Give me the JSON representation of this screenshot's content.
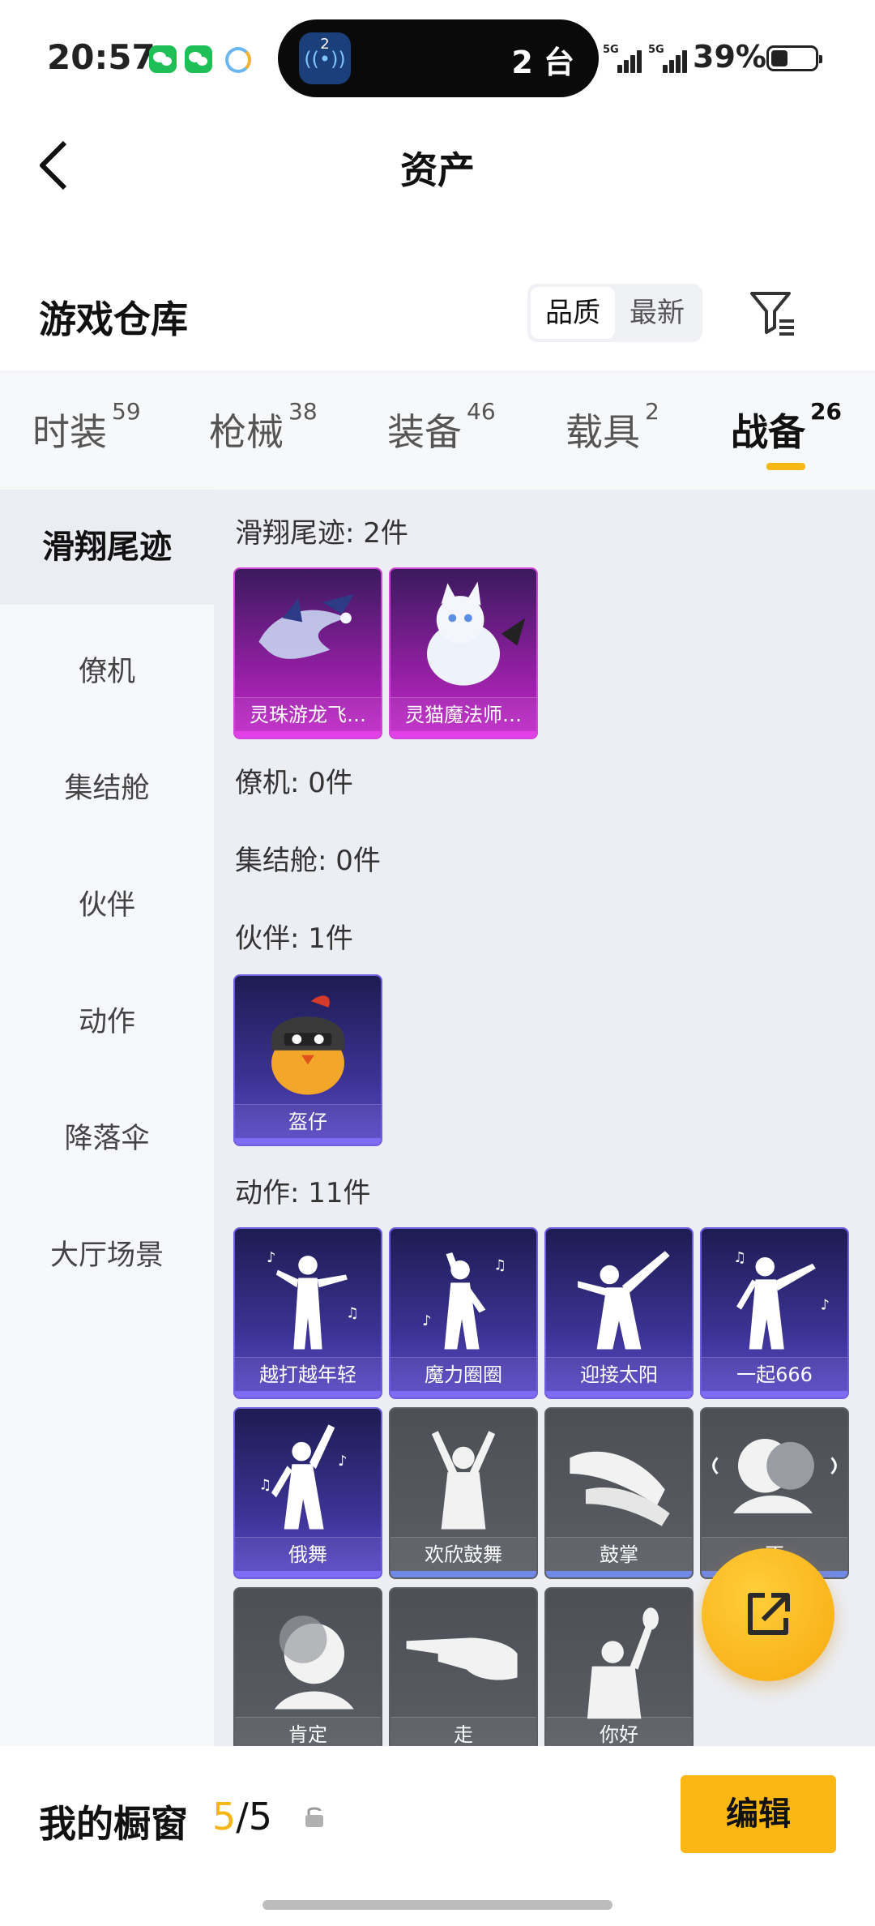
{
  "status_bar": {
    "time": "20:57",
    "island_app_badge": "2",
    "island_text": "2 台",
    "network_1": "5G",
    "network_2": "5G",
    "battery_percent": "39%",
    "battery_level": 0.39
  },
  "nav": {
    "title": "资产",
    "back_icon": "chevron-left-icon"
  },
  "header": {
    "section_title": "游戏仓库",
    "sort_options": [
      "品质",
      "最新"
    ],
    "sort_selected": "品质",
    "filter_icon": "filter-icon"
  },
  "tabs": [
    {
      "label": "时装",
      "count": "59"
    },
    {
      "label": "枪械",
      "count": "38"
    },
    {
      "label": "装备",
      "count": "46"
    },
    {
      "label": "载具",
      "count": "2"
    },
    {
      "label": "战备",
      "count": "26",
      "active": true
    }
  ],
  "sidebar": {
    "items": [
      "滑翔尾迹",
      "僚机",
      "集结舱",
      "伙伴",
      "动作",
      "降落伞",
      "大厅场景"
    ],
    "selected": "滑翔尾迹"
  },
  "groups": {
    "glide": {
      "title": "滑翔尾迹: 2件",
      "items": [
        "灵珠游龙飞…",
        "灵猫魔法师…"
      ]
    },
    "wingman": {
      "title": "僚机: 0件"
    },
    "rally_pod": {
      "title": "集结舱: 0件"
    },
    "partner": {
      "title": "伙伴: 1件",
      "items": [
        "盔仔"
      ]
    },
    "emote": {
      "title": "动作: 11件",
      "items": [
        "越打越年轻",
        "魔力圈圈",
        "迎接太阳",
        "一起666",
        "俄舞",
        "欢欣鼓舞",
        "鼓掌",
        "不",
        "肯定",
        "走",
        "你好"
      ]
    }
  },
  "fab": {
    "icon": "share-external-icon"
  },
  "bottom_bar": {
    "label": "我的橱窗",
    "count_current": "5",
    "count_sep": "/",
    "count_total": "5",
    "lock_icon": "lock-icon",
    "edit_label": "编辑"
  },
  "colors": {
    "accent": "#f8b814",
    "purple_card": "#c32ac9",
    "violet_card": "#5b49c8",
    "gray_card": "#5c5e66"
  }
}
